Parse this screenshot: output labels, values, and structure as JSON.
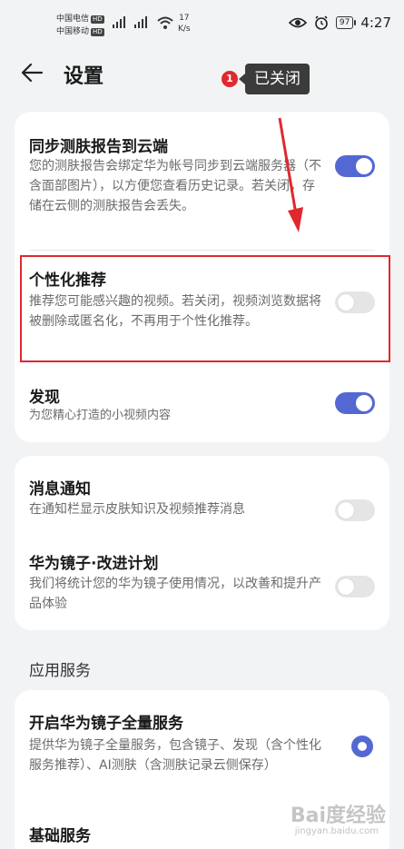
{
  "status_bar": {
    "carrier1": "中国电信",
    "carrier2": "中国移动",
    "hd": "HD",
    "speed_value": "17",
    "speed_unit": "K/s",
    "battery": "97",
    "time": "4:27"
  },
  "header": {
    "title": "设置"
  },
  "annotation": {
    "number": "1",
    "label": "已关闭"
  },
  "card1": {
    "sync": {
      "title": "同步测肤报告到云端",
      "desc": "您的测肤报告会绑定华为帐号同步到云端服务器（不含面部图片），以方便您查看历史记录。若关闭，存储在云侧的测肤报告会丢失。",
      "enabled": true
    },
    "personalized": {
      "title": "个性化推荐",
      "desc": "推荐您可能感兴趣的视频。若关闭，视频浏览数据将被删除或匿名化，不再用于个性化推荐。",
      "enabled": false
    },
    "discover": {
      "title": "发现",
      "desc": "为您精心打造的小视频内容",
      "enabled": true
    }
  },
  "card2": {
    "notify": {
      "title": "消息通知",
      "desc": "在通知栏显示皮肤知识及视频推荐消息",
      "enabled": false
    },
    "improve": {
      "title": "华为镜子·改进计划",
      "desc": "我们将统计您的华为镜子使用情况，以改善和提升产品体验",
      "enabled": false
    }
  },
  "section": {
    "label": "应用服务"
  },
  "card3": {
    "full_service": {
      "title": "开启华为镜子全量服务",
      "desc": "提供华为镜子全量服务，包含镜子、发现（含个性化服务推荐）、AI测肤（含测肤记录云侧保存）",
      "selected": true
    },
    "basic_service": {
      "title": "基础服务"
    }
  },
  "watermark": {
    "text": "Bai度经验",
    "sub": "jingyan.baidu.com"
  },
  "colors": {
    "accent": "#5468d4",
    "annotation_red": "#e0282e",
    "background": "#f1f3f5"
  }
}
